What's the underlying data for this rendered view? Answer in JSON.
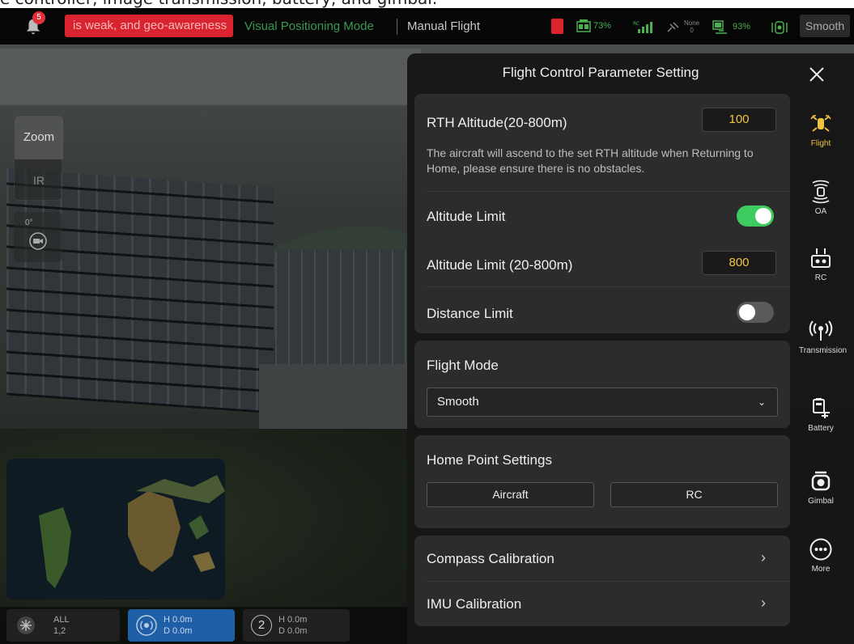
{
  "caption": "e controller, image transmission, battery, and gimbal.",
  "statusbar": {
    "notification_count": "5",
    "warning_text": "is weak, and geo-awareness",
    "positioning_mode": "Visual Positioning Mode",
    "flight_mode": "Manual Flight",
    "rc_battery": "73%",
    "gps_label": "None",
    "gps_count": "0",
    "aircraft_battery": "93%",
    "mode_chip": "Smooth"
  },
  "left_controls": {
    "zoom_label": "Zoom",
    "ir_label": "IR",
    "gimbal_angle": "0°"
  },
  "bottom": {
    "all_label": "ALL",
    "all_sub": "1,2",
    "chip1_h": "H 0.0m",
    "chip1_d": "D 0.0m",
    "chip2_num": "2",
    "chip2_h": "H 0.0m",
    "chip2_d": "D 0.0m"
  },
  "panel": {
    "title": "Flight Control Parameter Setting",
    "rth_label": "RTH Altitude(20-800m)",
    "rth_value": "100",
    "rth_desc": "The aircraft will ascend to the set RTH altitude when Returning to Home, please ensure there is no obstacles.",
    "alt_limit_label": "Altitude Limit",
    "alt_limit_on": true,
    "alt_limit_value_label": "Altitude Limit (20-800m)",
    "alt_limit_value": "800",
    "distance_limit_label": "Distance Limit",
    "distance_limit_on": false,
    "flight_mode_label": "Flight Mode",
    "flight_mode_value": "Smooth",
    "home_point_label": "Home Point Settings",
    "home_aircraft": "Aircraft",
    "home_rc": "RC",
    "compass_label": "Compass Calibration",
    "imu_label": "IMU Calibration"
  },
  "nav": [
    {
      "label": "Flight",
      "icon": "flight-icon",
      "active": true
    },
    {
      "label": "OA",
      "icon": "obstacle-avoidance-icon",
      "active": false
    },
    {
      "label": "RC",
      "icon": "remote-controller-icon",
      "active": false
    },
    {
      "label": "Transmission",
      "icon": "transmission-icon",
      "active": false
    },
    {
      "label": "Battery",
      "icon": "battery-icon",
      "active": false
    },
    {
      "label": "Gimbal",
      "icon": "gimbal-icon",
      "active": false
    },
    {
      "label": "More",
      "icon": "more-icon",
      "active": false
    }
  ],
  "colors": {
    "accent_yellow": "#f0c443",
    "toggle_on": "#3ecb5f",
    "warning_red": "#d9232e",
    "status_green": "#4caf50"
  }
}
